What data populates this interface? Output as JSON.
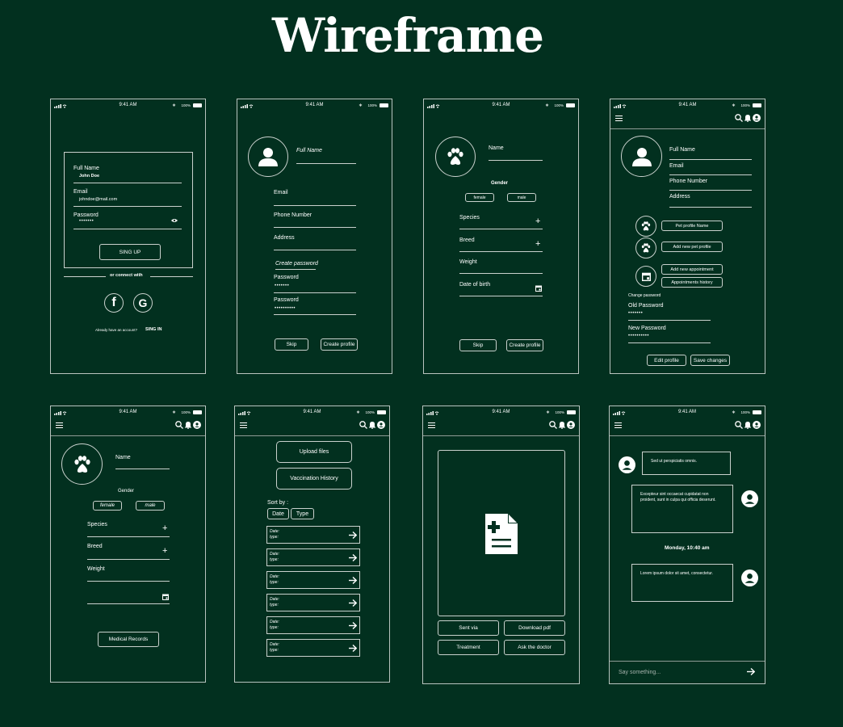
{
  "page_title": "Wireframe",
  "status": {
    "time": "9:41 AM",
    "battery": "100%",
    "bt": "∗"
  },
  "signup": {
    "full_name_label": "Full Name",
    "full_name_value": "John Doe",
    "email_label": "Email",
    "email_value": "johndoe@mail.com",
    "password_label": "Password",
    "password_value": "•••••••",
    "signup_button": "SING UP",
    "or_connect": "or connect with",
    "have_account": "Already have an account?",
    "sign_in": "SING IN"
  },
  "profile": {
    "full_name_label": "Full Name",
    "email_label": "Email",
    "phone_label": "Phone Number",
    "address_label": "Address",
    "create_password": "Create password",
    "password1_label": "Password",
    "password1_value": "•••••••",
    "password2_label": "Password",
    "password2_value": "••••••••••",
    "skip": "Skip",
    "create": "Create profile"
  },
  "pet": {
    "name_label": "Name",
    "gender_label": "Gender",
    "female": "female",
    "male": "male",
    "species": "Species",
    "breed": "Breed",
    "weight": "Weight",
    "dob": "Date of birth",
    "skip": "Skip",
    "create": "Create profile"
  },
  "edit": {
    "full_name": "Full Name",
    "email": "Email",
    "phone": "Phone Number",
    "address": "Address",
    "pet_profile_name": "Pet profile Name",
    "add_pet": "Add new pet profile",
    "add_appt": "Add new appointment",
    "appt_history": "Appointments history",
    "change_password": "Change password",
    "old_pw": "Old Password",
    "old_pw_value": "•••••••",
    "new_pw": "New Password",
    "new_pw_value": "••••••••••",
    "edit_profile": "Edit profile",
    "save": "Save changes"
  },
  "pet_view": {
    "name": "Name",
    "gender": "Gender",
    "female": "female",
    "male": "male",
    "species": "Species",
    "breed": "Breed",
    "weight": "Weight",
    "records": "Medical Records"
  },
  "files": {
    "upload": "Upload files",
    "vacc": "Vaccination History",
    "sort_by": "Sort by :",
    "sort_date": "Date",
    "sort_type": "Type",
    "rows": [
      {
        "date": "Date:",
        "type": "type:"
      },
      {
        "date": "Date:",
        "type": "type:"
      },
      {
        "date": "Date:",
        "type": "type:"
      },
      {
        "date": "Date:",
        "type": "type:"
      },
      {
        "date": "Date:",
        "type": "type:"
      },
      {
        "date": "Date:",
        "type": "type:"
      }
    ]
  },
  "doc": {
    "sent_via": "Sent via",
    "download": "Download pdf",
    "treatment": "Treatment",
    "ask": "Ask the doctor"
  },
  "chat": {
    "msg1": "Sed ut perspiciatis omnis.",
    "msg2": "Excepteur sint occaecat cupidatat non proident, sunt in culpa qui officia deserunt.",
    "day": "Monday, 10:40 am",
    "msg3": "Lorem ipsum dolor sit amet, consectetur.",
    "placeholder": "Say something..."
  }
}
